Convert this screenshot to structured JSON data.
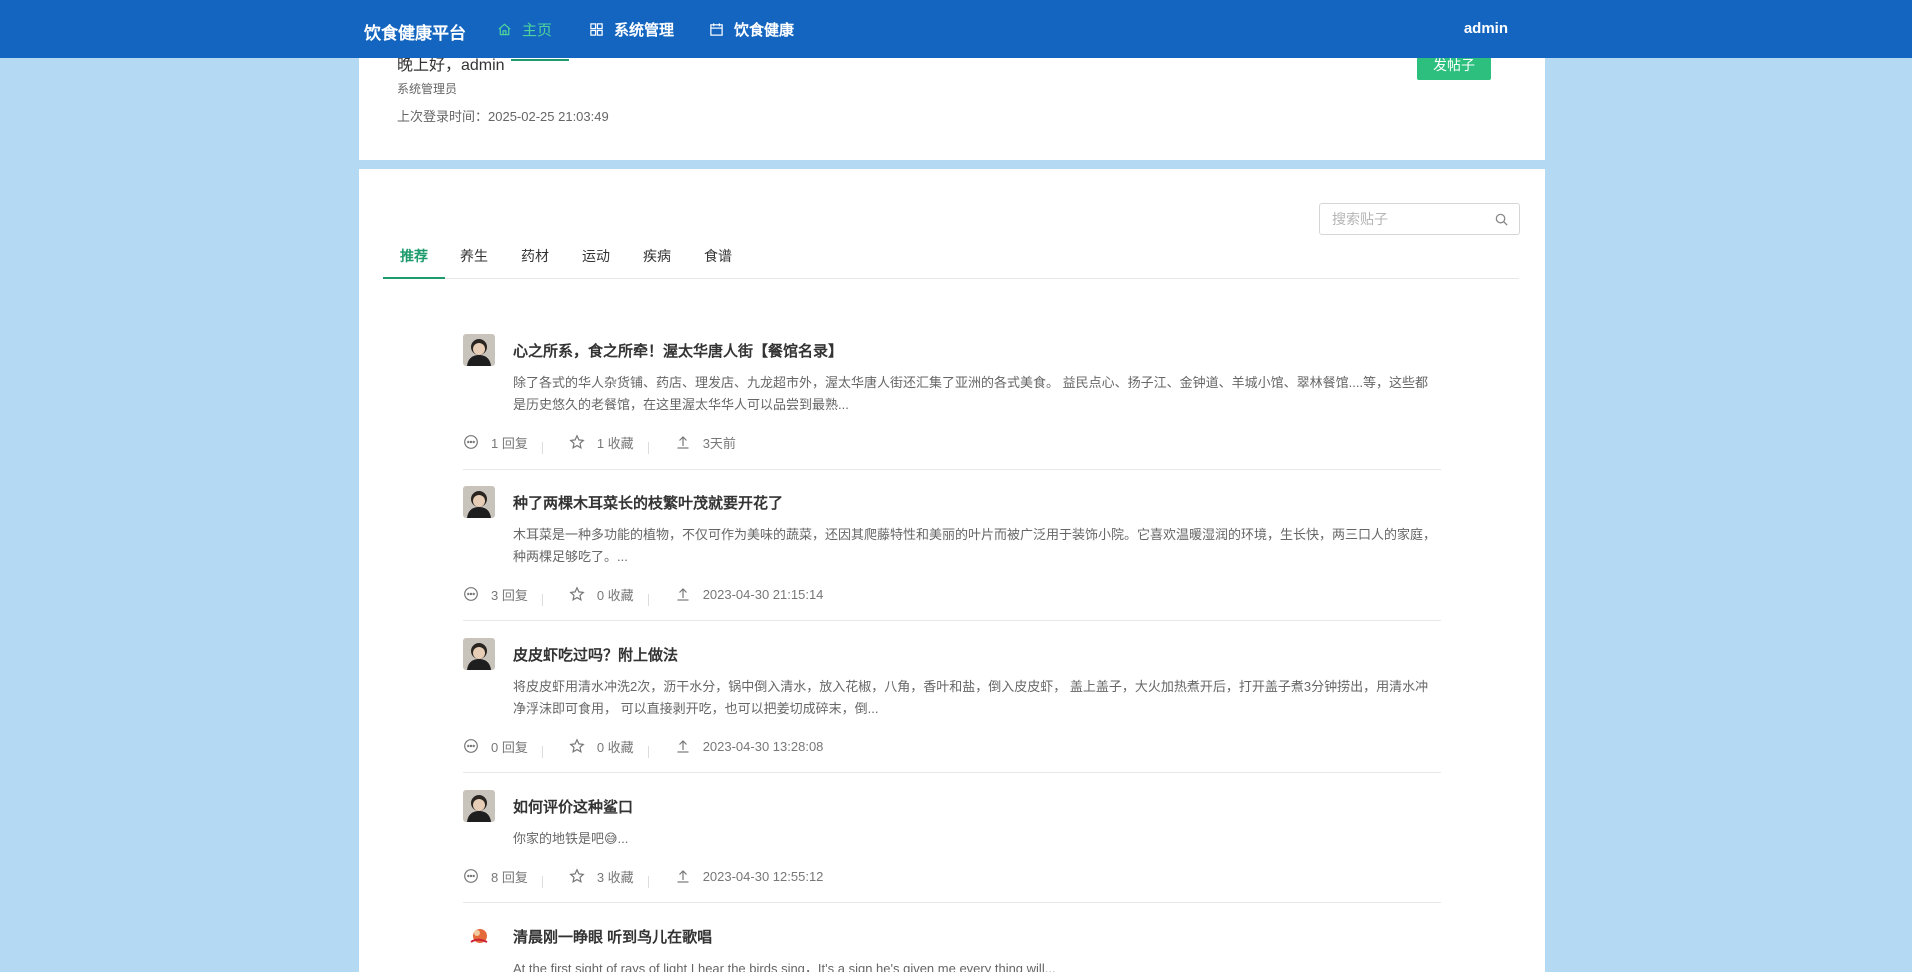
{
  "nav": {
    "brand": "饮食健康平台",
    "items": [
      {
        "label": "主页",
        "icon": "home-icon",
        "active": true
      },
      {
        "label": "系统管理",
        "icon": "grid-icon",
        "active": false
      },
      {
        "label": "饮食健康",
        "icon": "calendar-icon",
        "active": false
      }
    ],
    "user": "admin"
  },
  "profile": {
    "greeting": "晚上好，admin",
    "role": "系统管理员",
    "last_login": "上次登录时间：2025-02-25 21:03:49",
    "post_button": "发帖子"
  },
  "search": {
    "placeholder": "搜索贴子"
  },
  "tabs": [
    "推荐",
    "养生",
    "药材",
    "运动",
    "疾病",
    "食谱"
  ],
  "active_tab": "推荐",
  "posts": [
    {
      "title": "心之所系，食之所牵！渥太华唐人街【餐馆名录】",
      "excerpt": "除了各式的华人杂货铺、药店、理发店、九龙超市外，渥太华唐人街还汇集了亚洲的各式美食。 益民点心、扬子江、金钟道、羊城小馆、翠林餐馆....等，这些都是历史悠久的老餐馆，在这里渥太华华人可以品尝到最熟...",
      "replies": "1 回复",
      "favorites": "1 收藏",
      "time": "3天前"
    },
    {
      "title": "种了两棵木耳菜长的枝繁叶茂就要开花了",
      "excerpt": "木耳菜是一种多功能的植物，不仅可作为美味的蔬菜，还因其爬藤特性和美丽的叶片而被广泛用于装饰小院。它喜欢温暖湿润的环境，生长快，两三口人的家庭，种两棵足够吃了。...",
      "replies": "3 回复",
      "favorites": "0 收藏",
      "time": "2023-04-30 21:15:14"
    },
    {
      "title": "皮皮虾吃过吗？附上做法",
      "excerpt": "将皮皮虾用清水冲洗2次，沥干水分，锅中倒入清水，放入花椒，八角，香叶和盐，倒入皮皮虾， 盖上盖子，大火加热煮开后，打开盖子煮3分钟捞出，用清水冲净浮沫即可食用， 可以直接剥开吃，也可以把姜切成碎末，倒...",
      "replies": "0 回复",
      "favorites": "0 收藏",
      "time": "2023-04-30 13:28:08"
    },
    {
      "title": "如何评价这种鲨口",
      "excerpt": "你家的地铁是吧😅...",
      "replies": "8 回复",
      "favorites": "3 收藏",
      "time": "2023-04-30 12:55:12"
    },
    {
      "title": "清晨刚一睁眼 听到鸟儿在歌唱",
      "excerpt": "At the first sight of rays of light I hear the birds sing，It's a sign he's given me every thing will...",
      "replies": "",
      "favorites": "",
      "time": ""
    }
  ],
  "colors": {
    "nav_bg": "#1365c0",
    "page_bg": "#b4d9f3",
    "accent_green": "#1d9b6c",
    "button_green": "#2dbf7e"
  }
}
